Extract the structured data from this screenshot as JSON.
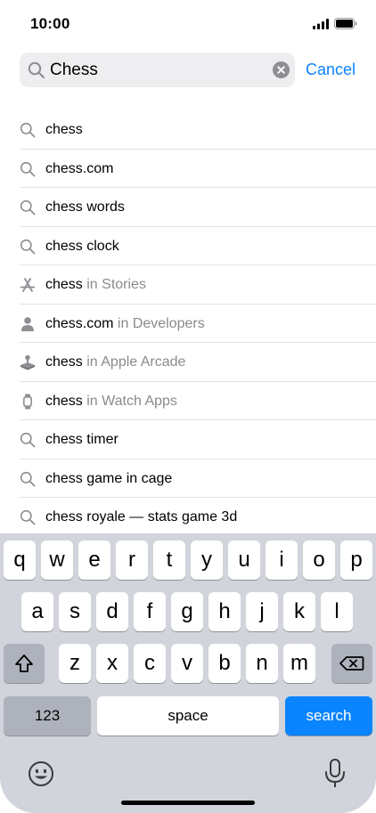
{
  "status_bar": {
    "time": "10:00"
  },
  "search": {
    "value": "Chess",
    "cancel_label": "Cancel"
  },
  "suggestions": [
    {
      "icon": "search-icon",
      "text": "chess",
      "suffix": ""
    },
    {
      "icon": "search-icon",
      "text": "chess.com",
      "suffix": ""
    },
    {
      "icon": "search-icon",
      "text": "chess words",
      "suffix": ""
    },
    {
      "icon": "search-icon",
      "text": "chess clock",
      "suffix": ""
    },
    {
      "icon": "app-store-icon",
      "text": "chess",
      "suffix": " in Stories"
    },
    {
      "icon": "person-icon",
      "text": "chess.com",
      "suffix": " in Developers"
    },
    {
      "icon": "joystick-icon",
      "text": "chess",
      "suffix": " in Apple Arcade"
    },
    {
      "icon": "watch-icon",
      "text": "chess",
      "suffix": " in Watch Apps"
    },
    {
      "icon": "search-icon",
      "text": "chess timer",
      "suffix": ""
    },
    {
      "icon": "search-icon",
      "text": "chess game in cage",
      "suffix": ""
    },
    {
      "icon": "search-icon",
      "text": "chess royale — stats game 3d",
      "suffix": ""
    }
  ],
  "keyboard": {
    "row1": [
      "q",
      "w",
      "e",
      "r",
      "t",
      "y",
      "u",
      "i",
      "o",
      "p"
    ],
    "row2": [
      "a",
      "s",
      "d",
      "f",
      "g",
      "h",
      "j",
      "k",
      "l"
    ],
    "row3": [
      "z",
      "x",
      "c",
      "v",
      "b",
      "n",
      "m"
    ],
    "numbers_label": "123",
    "space_label": "space",
    "search_label": "search"
  },
  "colors": {
    "accent": "#0a84ff",
    "keyboard_bg": "#d1d4db",
    "secondary_text": "#8a8a8e"
  }
}
